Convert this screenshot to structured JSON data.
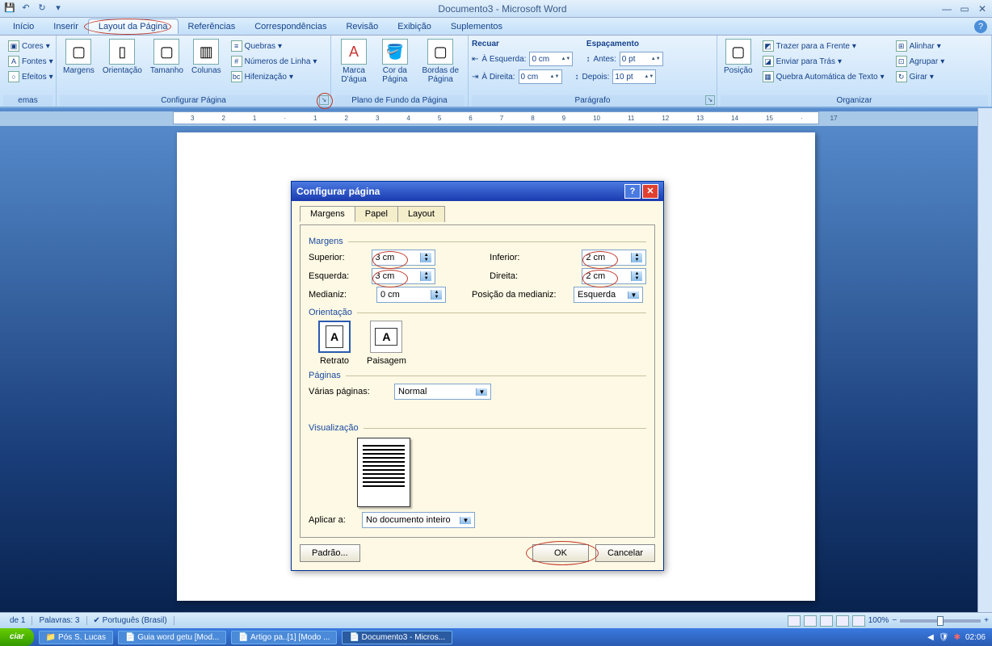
{
  "title": "Documento3 - Microsoft Word",
  "tabs": [
    "Início",
    "Inserir",
    "Layout da Página",
    "Referências",
    "Correspondências",
    "Revisão",
    "Exibição",
    "Suplementos"
  ],
  "active_tab": "Layout da Página",
  "ribbon": {
    "temas": {
      "label": "emas",
      "cores": "Cores",
      "fontes": "Fontes",
      "efeitos": "Efeitos"
    },
    "configurar": {
      "label": "Configurar Página",
      "margens": "Margens",
      "orientacao": "Orientação",
      "tamanho": "Tamanho",
      "colunas": "Colunas",
      "quebras": "Quebras",
      "numeros": "Números de Linha",
      "hifen": "Hifenização"
    },
    "fundo": {
      "label": "Plano de Fundo da Página",
      "marca": "Marca D'água",
      "cor": "Cor da Página",
      "bordas": "Bordas de Página"
    },
    "paragrafo": {
      "label": "Parágrafo",
      "recuar": "Recuar",
      "esquerda": "À Esquerda:",
      "direita": "À Direita:",
      "espac": "Espaçamento",
      "antes": "Antes:",
      "depois": "Depois:",
      "v_esq": "0 cm",
      "v_dir": "0 cm",
      "v_antes": "0 pt",
      "v_depois": "10 pt"
    },
    "organizar": {
      "label": "Organizar",
      "posicao": "Posição",
      "trazer": "Trazer para a Frente",
      "enviar": "Enviar para Trás",
      "quebra": "Quebra Automática de Texto",
      "alinhar": "Alinhar",
      "agrupar": "Agrupar",
      "girar": "Girar"
    }
  },
  "dialog": {
    "title": "Configurar página",
    "tabs": [
      "Margens",
      "Papel",
      "Layout"
    ],
    "margens_lbl": "Margens",
    "superior": "Superior:",
    "inferior": "Inferior:",
    "esquerda": "Esquerda:",
    "direita": "Direita:",
    "medianiz": "Medianiz:",
    "pos_med": "Posição da medianiz:",
    "v_sup": "3 cm",
    "v_inf": "2 cm",
    "v_esq": "3 cm",
    "v_dir": "2 cm",
    "v_med": "0 cm",
    "v_posmed": "Esquerda",
    "orientacao": "Orientação",
    "retrato": "Retrato",
    "paisagem": "Paisagem",
    "paginas": "Páginas",
    "varias": "Várias páginas:",
    "v_varias": "Normal",
    "visual": "Visualização",
    "aplicar": "Aplicar a:",
    "v_aplicar": "No documento inteiro",
    "padrao": "Padrão...",
    "ok": "OK",
    "cancelar": "Cancelar"
  },
  "status": {
    "pag": "de 1",
    "palavras": "Palavras: 3",
    "idioma": "Português (Brasil)",
    "zoom": "100%"
  },
  "taskbar": {
    "start": "ciar",
    "items": [
      "Pós S. Lucas",
      "Guia word getu [Mod...",
      "Artigo pa..[1] [Modo ...",
      "Documento3 - Micros..."
    ],
    "time": "02:06"
  }
}
